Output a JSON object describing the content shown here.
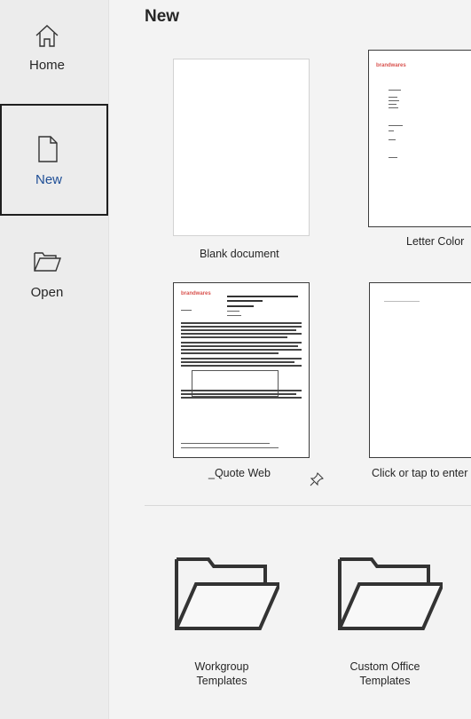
{
  "sidebar": {
    "items": [
      {
        "label": "Home",
        "icon": "home-icon"
      },
      {
        "label": "New",
        "icon": "new-document-icon",
        "selected": true
      },
      {
        "label": "Open",
        "icon": "open-folder-icon"
      }
    ]
  },
  "main": {
    "title": "New",
    "templates": [
      {
        "label": "Blank document"
      },
      {
        "label": "Letter Color",
        "logo": "brandwares"
      },
      {
        "label": "_Quote Web",
        "logo": "brandwares"
      },
      {
        "label": "Click or tap to enter a"
      }
    ],
    "folders": [
      {
        "label_line1": "Workgroup",
        "label_line2": "Templates"
      },
      {
        "label_line1": "Custom Office",
        "label_line2": "Templates"
      }
    ]
  },
  "colors": {
    "accent": "#1e4e96",
    "logo_red": "#d9534f"
  }
}
